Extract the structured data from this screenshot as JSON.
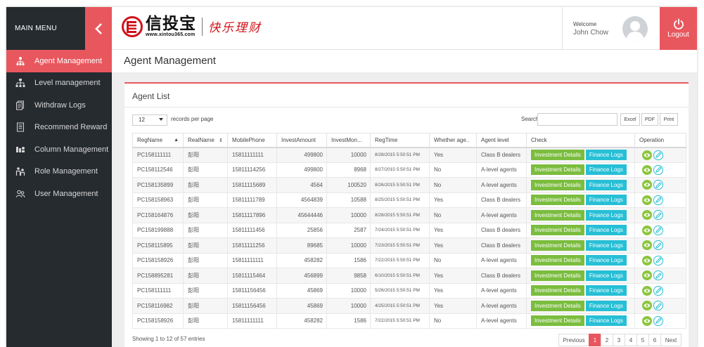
{
  "sidebar": {
    "title": "MAIN MENU",
    "items": [
      {
        "label": "Agent Management",
        "active": true,
        "icon": "org-chart-icon"
      },
      {
        "label": "Level management",
        "active": false,
        "icon": "hierarchy-icon"
      },
      {
        "label": "Withdraw Logs",
        "active": false,
        "icon": "documents-icon"
      },
      {
        "label": "Recommend Reward",
        "active": false,
        "icon": "document-icon"
      },
      {
        "label": "Column Management",
        "active": false,
        "icon": "columns-icon"
      },
      {
        "label": "Role Management",
        "active": false,
        "icon": "role-icon"
      },
      {
        "label": "User Management",
        "active": false,
        "icon": "users-icon"
      }
    ]
  },
  "header": {
    "logo_text": "信投宝",
    "logo_url": "www.xintou365.com",
    "slogan": "快乐理财",
    "welcome": "Welcome",
    "username": "John Chow",
    "logout_label": "Logout"
  },
  "page": {
    "title": "Agent Management"
  },
  "panel": {
    "title": "Agent List",
    "length_value": "12",
    "length_text": "records per page",
    "search_label": "Search:",
    "search_value": "",
    "tools": [
      "Excel",
      "PDF",
      "Print"
    ],
    "columns": [
      "RegName",
      "RealName",
      "MobilePhone",
      "InvestAmount",
      "InvestMon...",
      "RegTime",
      "Whether age..",
      "Agent level",
      "Check",
      "Operation"
    ],
    "check_buttons": {
      "investment": "Investment Details",
      "finance": "Finance Logs"
    },
    "rows": [
      [
        "PC158111111",
        "彭阳",
        "15811111111",
        "499800",
        "10000",
        "8/28/2015 5:50:51 PM",
        "Yes",
        "Class B dealers"
      ],
      [
        "PC158112546",
        "彭阳",
        "15811114256",
        "499800",
        "8968",
        "8/27/2015 5:50:51 PM",
        "No",
        "A-level agents"
      ],
      [
        "PC158135899",
        "彭阳",
        "15811115689",
        "4564",
        "100520",
        "8/26/2015 5:50:51 PM",
        "No",
        "A-level agents"
      ],
      [
        "PC158158963",
        "彭阳",
        "15811111789",
        "4564839",
        "10588",
        "8/25/2015 5:50:51 PM",
        "Yes",
        "Class B dealers"
      ],
      [
        "PC158164876",
        "彭阳",
        "15811117896",
        "45644446",
        "10000",
        "8/28/2015 5:50:51 PM",
        "No",
        "A-level agents"
      ],
      [
        "PC158199888",
        "彭阳",
        "15811111456",
        "25856",
        "2587",
        "7/24/2015 5:50:51 PM",
        "Yes",
        "Class B dealers"
      ],
      [
        "PC158115895",
        "彭阳",
        "15811111256",
        "89685",
        "10000",
        "7/23/2015 5:50:51 PM",
        "Yes",
        "Class B dealers"
      ],
      [
        "PC158158926",
        "彭阳",
        "15811111111",
        "458282",
        "1586",
        "7/22/2015 5:50:51 PM",
        "No",
        "A-level agents"
      ],
      [
        "PC158895281",
        "彭阳",
        "15811115464",
        "456899",
        "9858",
        "6/10/2015 5:50:51 PM",
        "Yes",
        "Class B dealers"
      ],
      [
        "PC158111111",
        "彭阳",
        "15811156456",
        "45869",
        "10000",
        "5/26/2015 5:50:51 PM",
        "Yes",
        "A-level agents"
      ],
      [
        "PC158116982",
        "彭阳",
        "15811156456",
        "45869",
        "10000",
        "4/25/2015 5:50:51 PM",
        "Yes",
        "A-level agents"
      ],
      [
        "PC158158926",
        "彭阳",
        "15811111111",
        "458282",
        "1586",
        "7/22/2015 5:50:51 PM",
        "No",
        "A-level agents"
      ]
    ],
    "showing": "Showing 1 to 12 of 57 entries",
    "pager": {
      "previous": "Previous",
      "pages": [
        "1",
        "2",
        "3",
        "4",
        "5",
        "6"
      ],
      "next": "Next",
      "current": "1"
    }
  },
  "colors": {
    "accent": "#e9575e",
    "sidebar": "#262b30",
    "green": "#7bbd3e",
    "cyan": "#27bfd6"
  }
}
